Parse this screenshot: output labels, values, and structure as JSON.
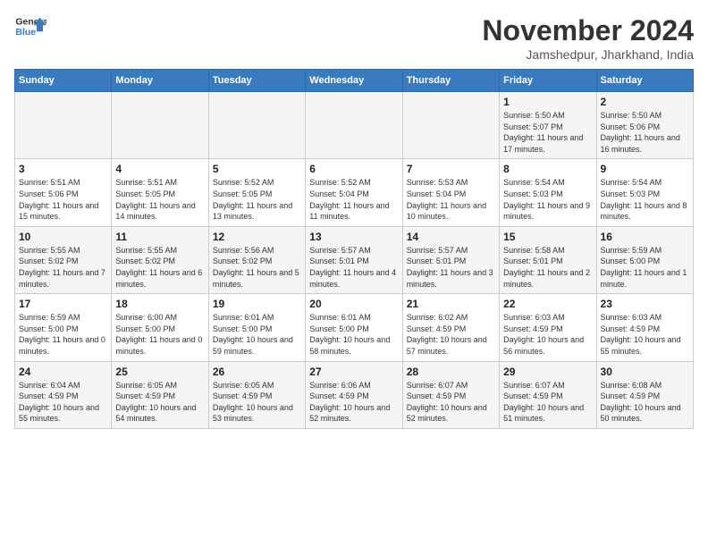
{
  "header": {
    "logo_line1": "General",
    "logo_line2": "Blue",
    "month": "November 2024",
    "location": "Jamshedpur, Jharkhand, India"
  },
  "weekdays": [
    "Sunday",
    "Monday",
    "Tuesday",
    "Wednesday",
    "Thursday",
    "Friday",
    "Saturday"
  ],
  "weeks": [
    [
      {
        "day": "",
        "info": ""
      },
      {
        "day": "",
        "info": ""
      },
      {
        "day": "",
        "info": ""
      },
      {
        "day": "",
        "info": ""
      },
      {
        "day": "",
        "info": ""
      },
      {
        "day": "1",
        "info": "Sunrise: 5:50 AM\nSunset: 5:07 PM\nDaylight: 11 hours and 17 minutes."
      },
      {
        "day": "2",
        "info": "Sunrise: 5:50 AM\nSunset: 5:06 PM\nDaylight: 11 hours and 16 minutes."
      }
    ],
    [
      {
        "day": "3",
        "info": "Sunrise: 5:51 AM\nSunset: 5:06 PM\nDaylight: 11 hours and 15 minutes."
      },
      {
        "day": "4",
        "info": "Sunrise: 5:51 AM\nSunset: 5:05 PM\nDaylight: 11 hours and 14 minutes."
      },
      {
        "day": "5",
        "info": "Sunrise: 5:52 AM\nSunset: 5:05 PM\nDaylight: 11 hours and 13 minutes."
      },
      {
        "day": "6",
        "info": "Sunrise: 5:52 AM\nSunset: 5:04 PM\nDaylight: 11 hours and 11 minutes."
      },
      {
        "day": "7",
        "info": "Sunrise: 5:53 AM\nSunset: 5:04 PM\nDaylight: 11 hours and 10 minutes."
      },
      {
        "day": "8",
        "info": "Sunrise: 5:54 AM\nSunset: 5:03 PM\nDaylight: 11 hours and 9 minutes."
      },
      {
        "day": "9",
        "info": "Sunrise: 5:54 AM\nSunset: 5:03 PM\nDaylight: 11 hours and 8 minutes."
      }
    ],
    [
      {
        "day": "10",
        "info": "Sunrise: 5:55 AM\nSunset: 5:02 PM\nDaylight: 11 hours and 7 minutes."
      },
      {
        "day": "11",
        "info": "Sunrise: 5:55 AM\nSunset: 5:02 PM\nDaylight: 11 hours and 6 minutes."
      },
      {
        "day": "12",
        "info": "Sunrise: 5:56 AM\nSunset: 5:02 PM\nDaylight: 11 hours and 5 minutes."
      },
      {
        "day": "13",
        "info": "Sunrise: 5:57 AM\nSunset: 5:01 PM\nDaylight: 11 hours and 4 minutes."
      },
      {
        "day": "14",
        "info": "Sunrise: 5:57 AM\nSunset: 5:01 PM\nDaylight: 11 hours and 3 minutes."
      },
      {
        "day": "15",
        "info": "Sunrise: 5:58 AM\nSunset: 5:01 PM\nDaylight: 11 hours and 2 minutes."
      },
      {
        "day": "16",
        "info": "Sunrise: 5:59 AM\nSunset: 5:00 PM\nDaylight: 11 hours and 1 minute."
      }
    ],
    [
      {
        "day": "17",
        "info": "Sunrise: 5:59 AM\nSunset: 5:00 PM\nDaylight: 11 hours and 0 minutes."
      },
      {
        "day": "18",
        "info": "Sunrise: 6:00 AM\nSunset: 5:00 PM\nDaylight: 11 hours and 0 minutes."
      },
      {
        "day": "19",
        "info": "Sunrise: 6:01 AM\nSunset: 5:00 PM\nDaylight: 10 hours and 59 minutes."
      },
      {
        "day": "20",
        "info": "Sunrise: 6:01 AM\nSunset: 5:00 PM\nDaylight: 10 hours and 58 minutes."
      },
      {
        "day": "21",
        "info": "Sunrise: 6:02 AM\nSunset: 4:59 PM\nDaylight: 10 hours and 57 minutes."
      },
      {
        "day": "22",
        "info": "Sunrise: 6:03 AM\nSunset: 4:59 PM\nDaylight: 10 hours and 56 minutes."
      },
      {
        "day": "23",
        "info": "Sunrise: 6:03 AM\nSunset: 4:59 PM\nDaylight: 10 hours and 55 minutes."
      }
    ],
    [
      {
        "day": "24",
        "info": "Sunrise: 6:04 AM\nSunset: 4:59 PM\nDaylight: 10 hours and 55 minutes."
      },
      {
        "day": "25",
        "info": "Sunrise: 6:05 AM\nSunset: 4:59 PM\nDaylight: 10 hours and 54 minutes."
      },
      {
        "day": "26",
        "info": "Sunrise: 6:05 AM\nSunset: 4:59 PM\nDaylight: 10 hours and 53 minutes."
      },
      {
        "day": "27",
        "info": "Sunrise: 6:06 AM\nSunset: 4:59 PM\nDaylight: 10 hours and 52 minutes."
      },
      {
        "day": "28",
        "info": "Sunrise: 6:07 AM\nSunset: 4:59 PM\nDaylight: 10 hours and 52 minutes."
      },
      {
        "day": "29",
        "info": "Sunrise: 6:07 AM\nSunset: 4:59 PM\nDaylight: 10 hours and 51 minutes."
      },
      {
        "day": "30",
        "info": "Sunrise: 6:08 AM\nSunset: 4:59 PM\nDaylight: 10 hours and 50 minutes."
      }
    ]
  ]
}
